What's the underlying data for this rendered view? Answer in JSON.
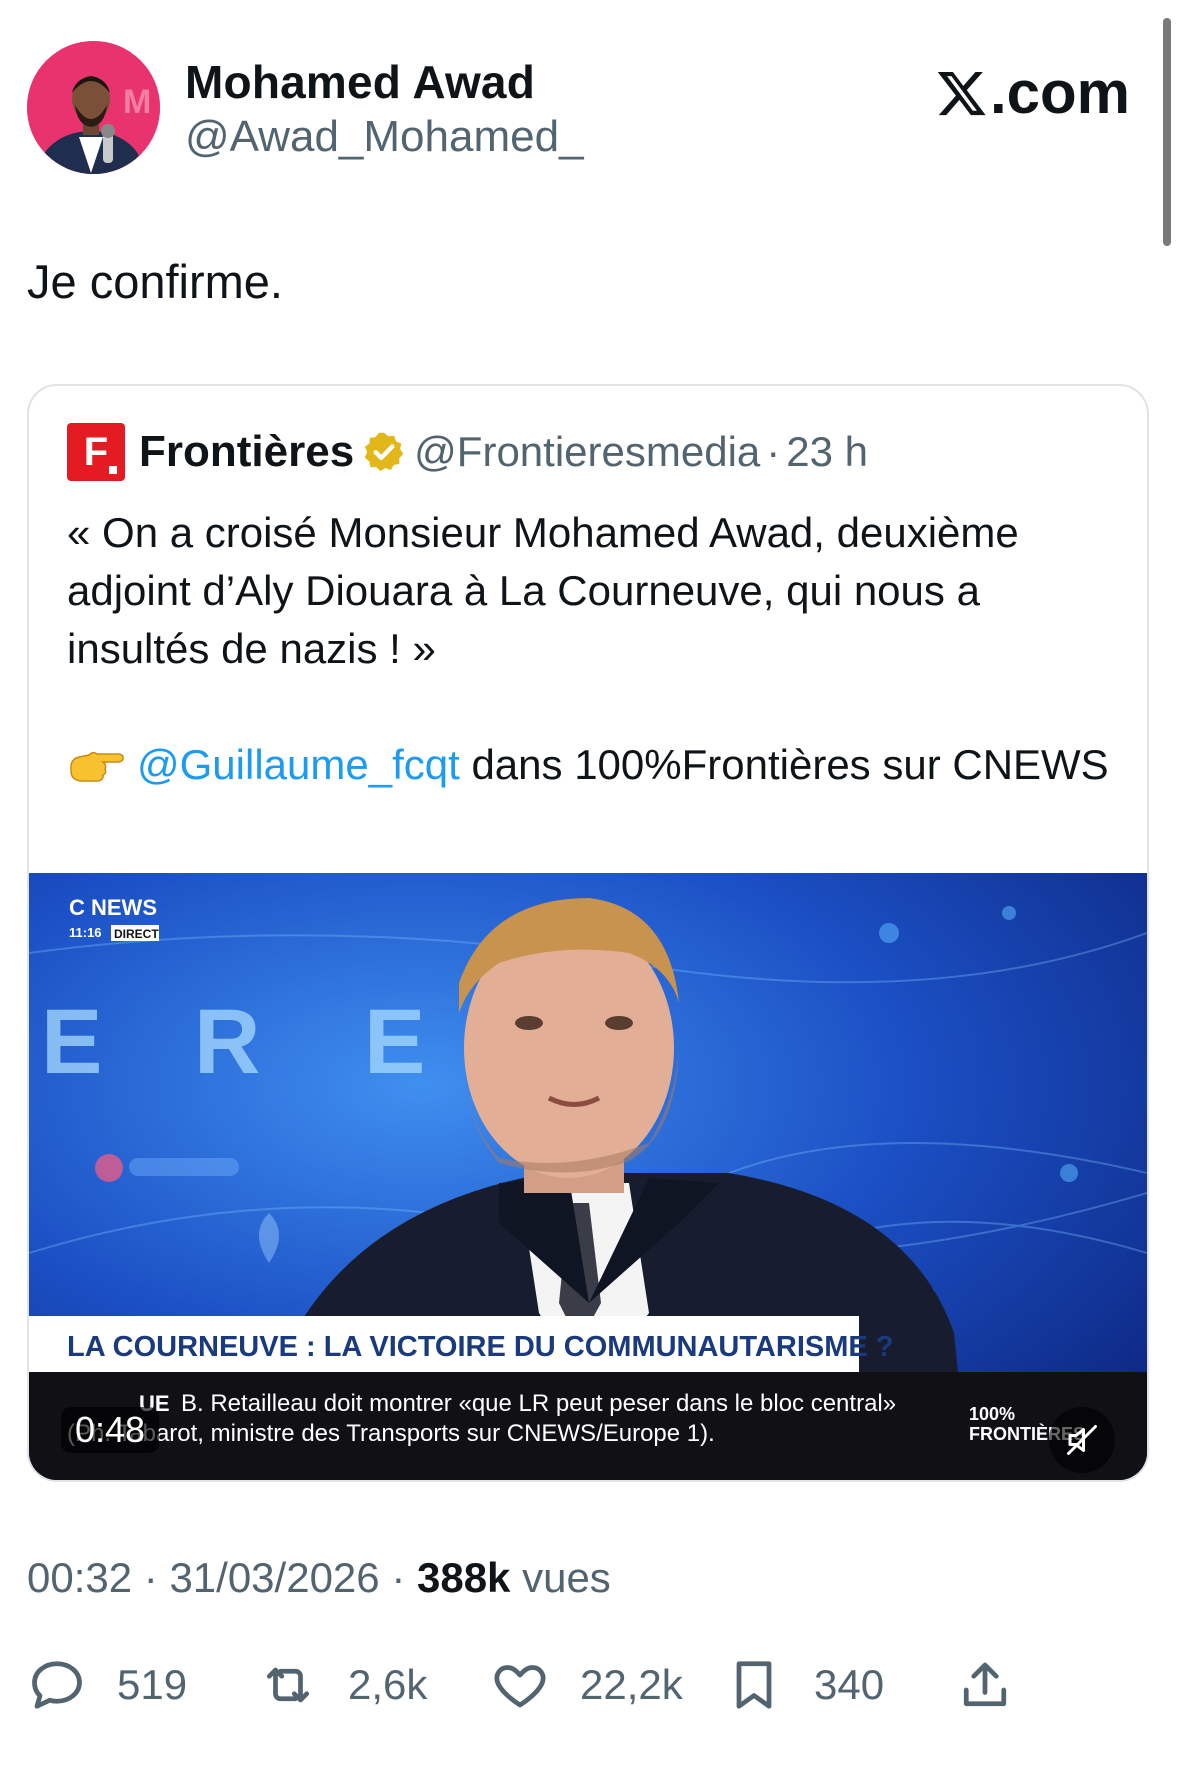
{
  "site": {
    "logo_text": ".com"
  },
  "author": {
    "name": "Mohamed Awad",
    "handle": "@Awad_Mohamed_"
  },
  "tweet": {
    "text": "Je confirme."
  },
  "quote": {
    "avatar_letter": "F",
    "name": "Frontières",
    "handle": "@Frontieresmedia",
    "separator": "·",
    "time": "23 h",
    "paragraph1": "« On a croisé Monsieur Mohamed Awad, deuxième adjoint d’Aly Diouara à La Courneuve, qui nous a insultés de nazis ! »",
    "mention": "@Guillaume_fcqt",
    "paragraph2_rest": " dans 100%Frontières sur CNEWS",
    "video": {
      "duration": "0:48",
      "channel_label": "C NEWS",
      "clock": "11:16",
      "live_label": "DIRECT",
      "backdrop_letters": [
        "E",
        "R",
        "E"
      ],
      "headline": "LA COURNEUVE : LA VICTOIRE DU COMMUNAUTARISME ?",
      "ticker_tag": "UE",
      "ticker_line1": "B. Retailleau doit montrer «que LR peut peser dans le bloc central»",
      "ticker_line2": "(Ph. Tabarot, ministre des Transports sur CNEWS/Europe 1).",
      "corner_brand_1": "100%",
      "corner_brand_2": "FRONTIÈRES"
    }
  },
  "meta": {
    "time": "00:32",
    "sep1": " · ",
    "date": "31/03/2026",
    "sep2": " · ",
    "views": "388k",
    "views_label": " vues"
  },
  "actions": {
    "replies": "519",
    "reposts": "2,6k",
    "likes": "22,2k",
    "bookmarks": "340"
  },
  "colors": {
    "mention": "#1d9bf0",
    "secondary_text": "#536471",
    "brand_red": "#e41b23",
    "verified_gold": "#e2b719"
  }
}
